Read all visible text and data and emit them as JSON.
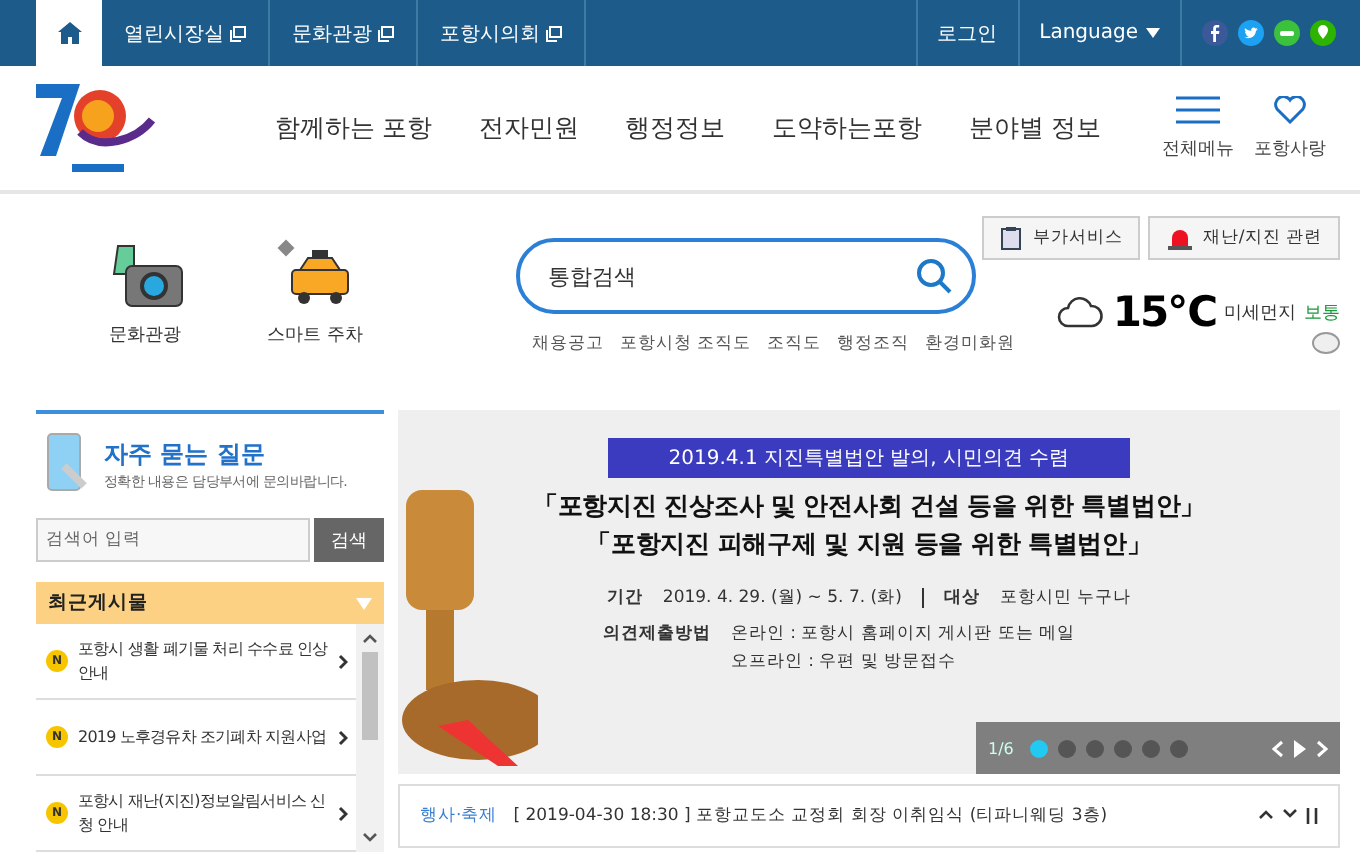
{
  "top_bar": {
    "links": [
      {
        "label": "열린시장실"
      },
      {
        "label": "문화관광"
      },
      {
        "label": "포항시의회"
      }
    ],
    "login": "로그인",
    "language": "Language"
  },
  "header": {
    "nav": [
      "함께하는 포항",
      "전자민원",
      "행정정보",
      "도약하는포항",
      "분야별 정보"
    ],
    "all_menu": "전체메뉴",
    "favorite": "포항사랑"
  },
  "quick_icons": [
    {
      "kind": "culture",
      "label": "문화관광"
    },
    {
      "kind": "parking",
      "label": "스마트 주차"
    }
  ],
  "search": {
    "placeholder": "통합검색",
    "keywords": [
      "채용공고",
      "포항시청 조직도",
      "조직도",
      "행정조직",
      "환경미화원"
    ]
  },
  "service_buttons": [
    "부가서비스",
    "재난/지진 관련"
  ],
  "weather": {
    "temperature": "15℃",
    "dust_label": "미세먼지",
    "dust_status": "보통"
  },
  "faq": {
    "title": "자주 묻는 질문",
    "subtitle": "정확한 내용은 담당부서에 문의바랍니다.",
    "placeholder": "검색어 입력",
    "button": "검색"
  },
  "recent_posts": {
    "title": "최근게시물",
    "items": [
      {
        "badge": "N",
        "text": "포항시 생활 폐기물 처리 수수료 인상 안내"
      },
      {
        "badge": "N",
        "text": "2019 노후경유차 조기폐차 지원사업"
      },
      {
        "badge": "N",
        "text": "포항시 재난(지진)정보알림서비스 신청 안내"
      }
    ]
  },
  "banner": {
    "heading": "2019.4.1 지진특별법안 발의, 시민의견 수렴",
    "title_lines": [
      "「포항지진 진상조사 및 안전사회 건설 등을 위한 특별법안」",
      "「포항지진 피해구제 및 지원 등을 위한 특별법안」"
    ],
    "period_label": "기간",
    "period": "2019. 4. 29. (월) ~ 5. 7. (화)",
    "target_label": "대상",
    "target": "포항시민 누구나",
    "method_label": "의견제출방법",
    "methods": [
      "온라인 : 포항시 홈페이지 게시판 또는 메일",
      "오프라인 : 우편 및 방문접수"
    ],
    "counter": "1/6",
    "slides": [
      {
        "selected": true
      },
      {
        "selected": false
      },
      {
        "selected": false
      },
      {
        "selected": false
      },
      {
        "selected": false
      },
      {
        "selected": false
      }
    ]
  },
  "ticker": {
    "category": "행사·축제",
    "text": "[ 2019-04-30 18:30 ] 포항교도소 교정회 회장 이취임식 (티파니웨딩 3층)"
  }
}
